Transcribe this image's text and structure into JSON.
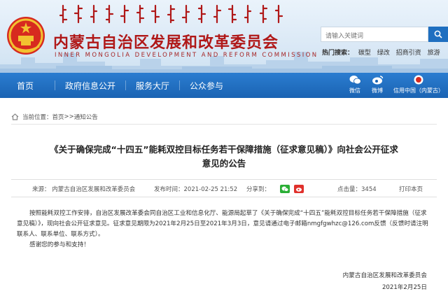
{
  "header": {
    "title_cn": "内蒙古自治区发展和改革委员会",
    "title_en": "INNER MONGOLIA DEVELOPMENT AND REFORM COMMISSION",
    "search_placeholder": "请输入关键词",
    "hot_label": "热门搜索：",
    "hot_keywords": [
      "碳型",
      "绿改",
      "招商引资",
      "旅游"
    ]
  },
  "nav": {
    "items": [
      "首页",
      "政府信息公开",
      "服务大厅",
      "公众参与"
    ],
    "wechat": "微信",
    "weibo": "微博",
    "credit": "信用中国（内蒙古）"
  },
  "breadcrumb": {
    "label": "当前位置：",
    "home": "首页",
    "sep": ">>",
    "current": "通知公告"
  },
  "article": {
    "title_line1": "《关于确保完成“十四五”能耗双控目标任务若干保障措施（征求意见稿）》向社会公开征求",
    "title_line2": "意见的公告",
    "source": "来源：  内蒙古自治区发展和改革委员会",
    "published": "发布时间：2021-02-25 21:52",
    "share_label": "分享到：",
    "clicks": "点击量：3454",
    "print": "打印本页",
    "para1": "按照能耗双控工作安排，自治区发展改革委会同自治区工业和信息化厅、能源局起草了《关于确保完成“十四五”能耗双控目标任务若干保障措施（征求意见稿）》，现向社会公开征求意见。征求意见期限为2021年2月25日至2021年3月3日，意见请通过电子邮箱nmgfgwhzc@126.com反馈（反馈时请注明联系人、联系单位、联系方式）。",
    "para2": "感谢您的参与和支持！",
    "sign_org": "内蒙古自治区发展和改革委员会",
    "sign_date": "2021年2月25日"
  },
  "colors": {
    "nav_blue": "#1a63b3",
    "title_red": "#b01818",
    "wechat_green": "#2aae35",
    "weibo_red": "#e0312c"
  }
}
